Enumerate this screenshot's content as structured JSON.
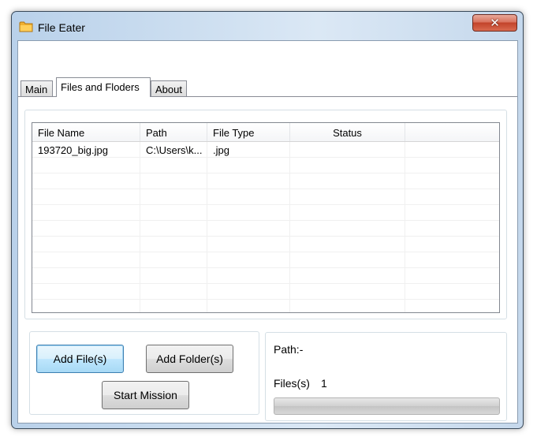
{
  "window": {
    "title": "File Eater",
    "icon": "folder-icon",
    "close_glyph": "✕"
  },
  "tabs": [
    {
      "label": "Main"
    },
    {
      "label": "Files and Floders",
      "active": true
    },
    {
      "label": "About"
    }
  ],
  "file_list": {
    "columns": [
      "File Name",
      "Path",
      "File Type",
      "Status",
      ""
    ],
    "rows": [
      [
        "193720_big.jpg",
        "C:\\Users\\k...",
        ".jpg",
        "",
        ""
      ]
    ]
  },
  "buttons": {
    "add_files": "Add File(s)",
    "add_folder": "Add Folder(s)",
    "start_mission": "Start Mission"
  },
  "info": {
    "path_label": "Path:-",
    "files_label": "Files(s)",
    "files_count": "1",
    "progress": 0
  },
  "colors": {
    "title_bar": "#cfe0f1",
    "close_button": "#c2432a",
    "focus_border": "#3c7fb1"
  }
}
